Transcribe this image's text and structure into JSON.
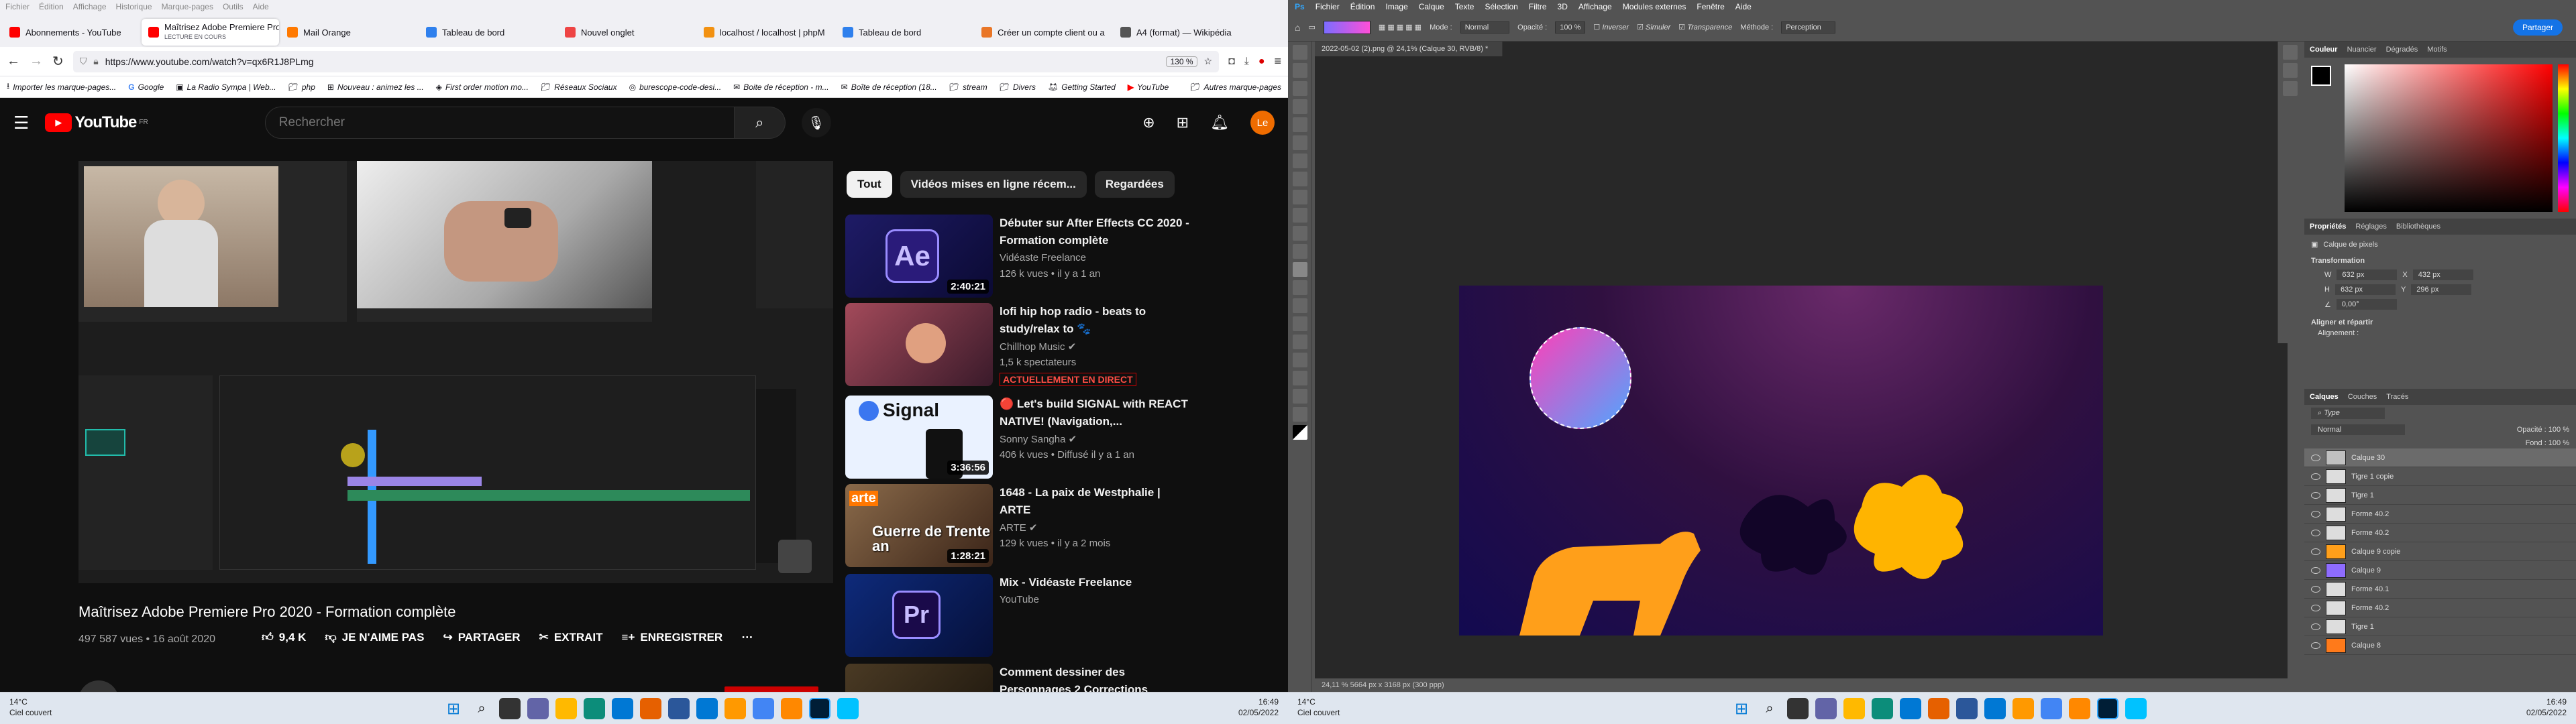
{
  "firefox": {
    "menu": [
      "Fichier",
      "Édition",
      "Affichage",
      "Historique",
      "Marque-pages",
      "Outils",
      "Aide"
    ],
    "tabs": [
      {
        "label": "Abonnements - YouTube",
        "color": "#ff0000"
      },
      {
        "label": "Maîtrisez Adobe Premiere Pro",
        "sub": "LECTURE EN COURS",
        "color": "#ff0000",
        "active": true
      },
      {
        "label": "Mail Orange",
        "color": "#ff7900"
      },
      {
        "label": "Tableau de bord",
        "color": "#2f80ed"
      },
      {
        "label": "Nouvel onglet",
        "color": "#4a90e2"
      },
      {
        "label": "localhost / localhost | phpM",
        "color": "#f29111"
      },
      {
        "label": "Tableau de bord",
        "color": "#2f80ed"
      },
      {
        "label": "Créer un compte client ou a",
        "color": "#e97627"
      },
      {
        "label": "A4 (format) — Wikipédia",
        "color": "#555555"
      }
    ],
    "url": "https://www.youtube.com/watch?v=qx6R1J8PLmg",
    "zoom": "130 %",
    "bookmarks": [
      "Importer les marque-pages...",
      "Google",
      "La Radio Sympa | Web...",
      "php",
      "Nouveau : animez les ...",
      "First order motion mo...",
      "Réseaux Sociaux",
      "burescope-code-desi...",
      "Boite de réception - m...",
      "Boîte de réception (18...",
      "stream",
      "Divers",
      "Getting Started",
      "YouTube",
      "Autres marque-pages"
    ]
  },
  "youtube": {
    "logo": "YouTube",
    "region": "FR",
    "search_placeholder": "Rechercher",
    "avatar": "Le",
    "video": {
      "title": "Maîtrisez Adobe Premiere Pro 2020 - Formation complète",
      "views_date": "497 587 vues • 16 août 2020",
      "likes": "9,4 K",
      "dislike": "JE N'AIME PAS",
      "share": "PARTAGER",
      "clip": "EXTRAIT",
      "save": "ENREGISTRER"
    },
    "chips": [
      "Tout",
      "Vidéos mises en ligne récem...",
      "Regardées"
    ],
    "recommendations": [
      {
        "title": "Débuter sur After Effects CC 2020 - Formation complète",
        "channel": "Vidéaste Freelance",
        "meta": "126 k vues • il y a 1 an",
        "duration": "2:40:21",
        "thumb": "#1a1950"
      },
      {
        "title": "lofi hip hop radio - beats to study/relax to 🐾",
        "channel": "Chillhop Music ✔",
        "meta": "1,5 k spectateurs",
        "live": "ACTUELLEMENT EN DIRECT",
        "thumb": "#6b2a3a"
      },
      {
        "title": "🔴 Let's build SIGNAL with REACT NATIVE! (Navigation,...",
        "channel": "Sonny Sangha ✔",
        "meta": "406 k vues • Diffusé il y a 1 an",
        "duration": "3:36:56",
        "thumb": "#eaf2ff"
      },
      {
        "title": "1648 - La paix de Westphalie | ARTE",
        "channel": "ARTE ✔",
        "meta": "129 k vues • il y a 2 mois",
        "duration": "1:28:21",
        "thumb": "#5a3a2a",
        "overlay": "Guerre de Trente an"
      },
      {
        "title": "Mix - Vidéaste Freelance",
        "channel": "YouTube",
        "meta": "",
        "thumb": "#0a1a4a"
      },
      {
        "title": "Comment dessiner des Personnages 2 Corrections",
        "channel": "",
        "meta": "",
        "thumb": "#30281c"
      }
    ]
  },
  "taskbar": {
    "weather_temp": "14°C",
    "weather_desc": "Ciel couvert",
    "time": "16:49",
    "date": "02/05/2022"
  },
  "photoshop": {
    "menu": [
      "Fichier",
      "Édition",
      "Image",
      "Calque",
      "Texte",
      "Sélection",
      "Filtre",
      "3D",
      "Affichage",
      "Modules externes",
      "Fenêtre",
      "Aide"
    ],
    "options": [
      "Mode :",
      "Normal",
      "Opacité :",
      "100 %",
      "Inverser",
      "Simuler",
      "Transparence",
      "Méthode :",
      "Perception"
    ],
    "share_label": "Partager",
    "doc_tab": "2022-05-02 (2).png @ 24,1% (Calque 30, RVB/8) *",
    "status": "24,11 %    5664 px x 3168 px (300 ppp)",
    "color_tabs": [
      "Couleur",
      "Nuancier",
      "Dégradés",
      "Motifs"
    ],
    "props_tabs": [
      "Propriétés",
      "Réglages",
      "Bibliothèques"
    ],
    "props": {
      "kind": "Calque de pixels",
      "transform": "Transformation",
      "w": "632 px",
      "h": "632 px",
      "x": "432 px",
      "y": "296 px",
      "angle": "0,00°",
      "align": "Aligner et répartir",
      "align_sub": "Alignement :"
    },
    "layer_tabs": [
      "Calques",
      "Couches",
      "Tracés"
    ],
    "layer_filter": "Type",
    "blend": "Normal",
    "opacity": "Opacité : 100 %",
    "fill": "Fond : 100 %",
    "layers": [
      {
        "name": "Calque 30",
        "thumb": "#c0c0c0"
      },
      {
        "name": "Tigre 1 copie",
        "thumb": "#dddddd"
      },
      {
        "name": "Tigre 1",
        "thumb": "#dddddd"
      },
      {
        "name": "Forme 40.2",
        "thumb": "#dddddd"
      },
      {
        "name": "Forme 40.2",
        "thumb": "#dddddd"
      },
      {
        "name": "Calque 9 copie",
        "thumb": "#ff9f1a"
      },
      {
        "name": "Calque 9",
        "thumb": "#8e6cff"
      },
      {
        "name": "Forme 40.1",
        "thumb": "#dddddd"
      },
      {
        "name": "Forme 40.2",
        "thumb": "#dddddd"
      },
      {
        "name": "Tigre 1",
        "thumb": "#dddddd"
      },
      {
        "name": "Calque 8",
        "thumb": "#ff7a1a"
      }
    ]
  },
  "colors": {
    "yt_red": "#ff0000",
    "ps_blue": "#1473e6"
  }
}
